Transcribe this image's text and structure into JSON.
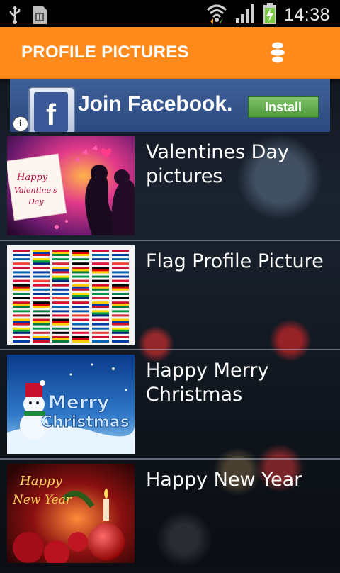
{
  "status_bar": {
    "time": "14:38",
    "icons": [
      "usb-icon",
      "sim-card-icon",
      "wifi-icon",
      "signal-icon",
      "battery-charging-icon"
    ]
  },
  "header": {
    "title": "PROFILE PICTURES",
    "menu_icon": "menu-icon",
    "background_color": "#ff8a1c"
  },
  "ad": {
    "logo_letter": "f",
    "text": "Join Facebook.",
    "button_label": "Install",
    "info_label": "i"
  },
  "items": [
    {
      "label": "Valentines Day pictures",
      "thumb_text_1": "Happy",
      "thumb_text_2": "Valentine's",
      "thumb_text_3": "Day"
    },
    {
      "label": "Flag Profile Picture"
    },
    {
      "label": "Happy Merry Christmas",
      "thumb_text_1": "Merry",
      "thumb_text_2": "Christmas"
    },
    {
      "label": "Happy New Year",
      "thumb_text_1": "Happy",
      "thumb_text_2": "New Year"
    }
  ]
}
